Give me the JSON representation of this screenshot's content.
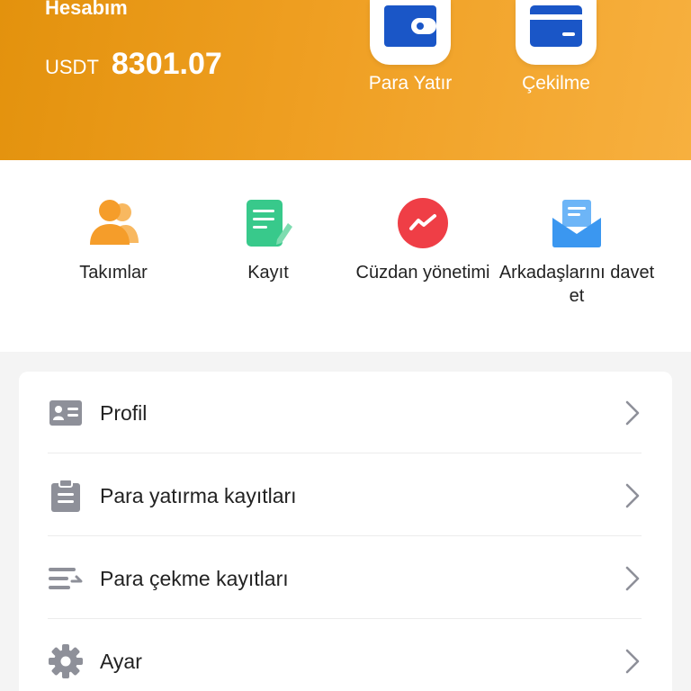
{
  "header": {
    "title": "Hesabım",
    "currency": "USDT",
    "balance": "8301.07",
    "deposit_label": "Para Yatır",
    "withdraw_label": "Çekilme"
  },
  "quick_actions": [
    {
      "label": "Takımlar",
      "icon": "team-icon",
      "color": "#f59d2a"
    },
    {
      "label": "Kayıt",
      "icon": "record-icon",
      "color": "#38c98b"
    },
    {
      "label": "Cüzdan yönetimi",
      "icon": "wallet-chart-icon",
      "color": "#ef3e46"
    },
    {
      "label": "Arkadaşlarını davet et",
      "icon": "invite-mail-icon",
      "color": "#3b97f0"
    }
  ],
  "menu": [
    {
      "label": "Profil",
      "icon": "id-card-icon"
    },
    {
      "label": "Para yatırma kayıtları",
      "icon": "clipboard-icon"
    },
    {
      "label": "Para çekme kayıtları",
      "icon": "transfer-list-icon"
    },
    {
      "label": "Ayar",
      "icon": "gear-icon"
    }
  ],
  "colors": {
    "header_start": "#e3920d",
    "header_end": "#f7b03f",
    "deposit_icon": "#1a56c7",
    "withdraw_icon": "#1a56c7",
    "menu_icon": "#8e9099"
  }
}
